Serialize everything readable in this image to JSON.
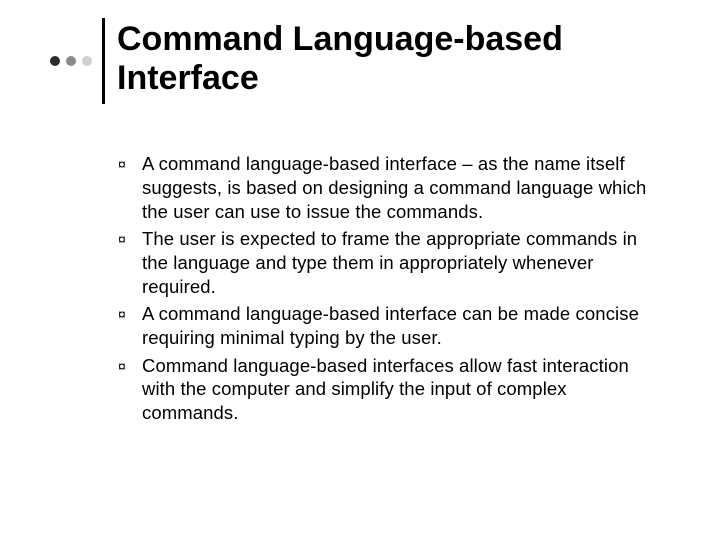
{
  "slide": {
    "title": "Command Language-based Interface",
    "bullets": [
      "A command language-based interface – as the name itself suggests, is based on designing a command language which the user can use to issue the commands.",
      "The user is expected to frame the appropriate commands in the language and type them in appropriately whenever required.",
      "A command language-based interface can be made concise requiring minimal typing by the user.",
      "Command language-based interfaces allow fast interaction with the computer and simplify the input of complex commands."
    ],
    "bullet_glyph": "¤"
  }
}
